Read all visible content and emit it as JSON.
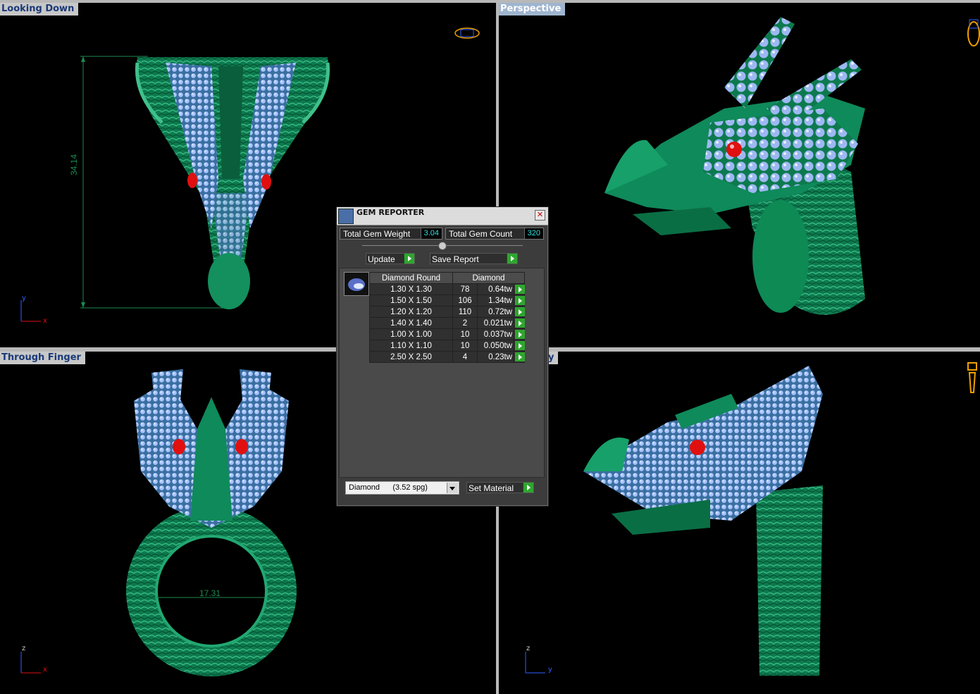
{
  "viewports": {
    "top_left": {
      "label": "Looking Down",
      "dimension": "34.14",
      "axis_v": "y",
      "axis_h": "x"
    },
    "top_right": {
      "label": "Perspective"
    },
    "bottom_left": {
      "label": "Through Finger",
      "dimension": "17.31",
      "axis_v": "z",
      "axis_h": "x"
    },
    "bottom_right": {
      "label": "y",
      "axis_v": "z",
      "axis_h": "y"
    }
  },
  "panel": {
    "title": "GEM REPORTER",
    "total_weight_label": "Total Gem Weight",
    "total_weight_value": "3.04",
    "total_count_label": "Total Gem Count",
    "total_count_value": "320",
    "update_label": "Update",
    "save_label": "Save Report",
    "table_headers": [
      "Diamond Round",
      "Diamond"
    ],
    "rows": [
      {
        "size": "1.30 X 1.30",
        "count": "78",
        "weight": "0.64tw"
      },
      {
        "size": "1.50 X 1.50",
        "count": "106",
        "weight": "1.34tw"
      },
      {
        "size": "1.20 X 1.20",
        "count": "110",
        "weight": "0.72tw"
      },
      {
        "size": "1.40 X 1.40",
        "count": "2",
        "weight": "0.021tw"
      },
      {
        "size": "1.00 X 1.00",
        "count": "10",
        "weight": "0.037tw"
      },
      {
        "size": "1.10 X 1.10",
        "count": "10",
        "weight": "0.050tw"
      },
      {
        "size": "2.50 X 2.50",
        "count": "4",
        "weight": "0.23tw"
      }
    ],
    "material_selected": "Diamond      (3.52 spg)",
    "set_material_label": "Set Material"
  },
  "colors": {
    "metal": "#0f8a5a",
    "gem": "#8fb0f0",
    "eye": "#e01010",
    "accent": "#2fa62f"
  }
}
